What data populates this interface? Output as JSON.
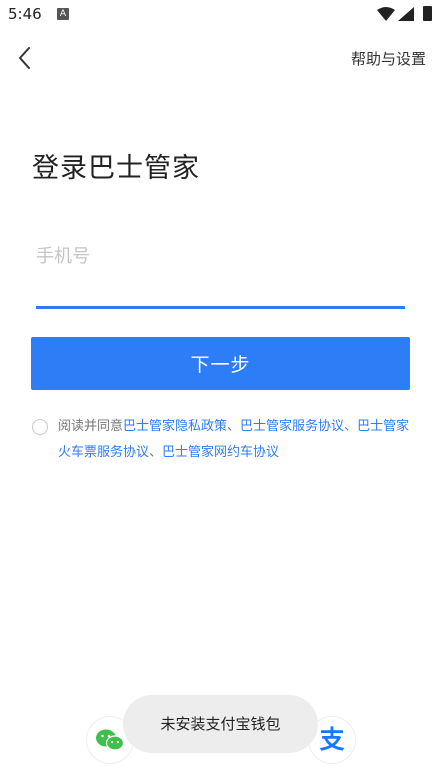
{
  "status_bar": {
    "time": "5:46",
    "notification_icon_letter": "A"
  },
  "header": {
    "help_label": "帮助与设置"
  },
  "main": {
    "title": "登录巴士管家",
    "phone_placeholder": "手机号",
    "phone_value": "",
    "next_label": "下一步"
  },
  "agreement": {
    "prefix": "阅读并同意",
    "links": [
      "巴士管家隐私政策",
      "巴士管家服务协议",
      "巴士管家火车票服务协议",
      "巴士管家网约车协议"
    ],
    "separator": "、"
  },
  "third_party": {
    "wechat_icon": "wechat-icon",
    "alipay_icon": "alipay-icon",
    "alipay_glyph": "支"
  },
  "toast": {
    "message": "未安装支付宝钱包"
  },
  "colors": {
    "accent": "#2d7df6",
    "toast_bg": "#ededed"
  }
}
